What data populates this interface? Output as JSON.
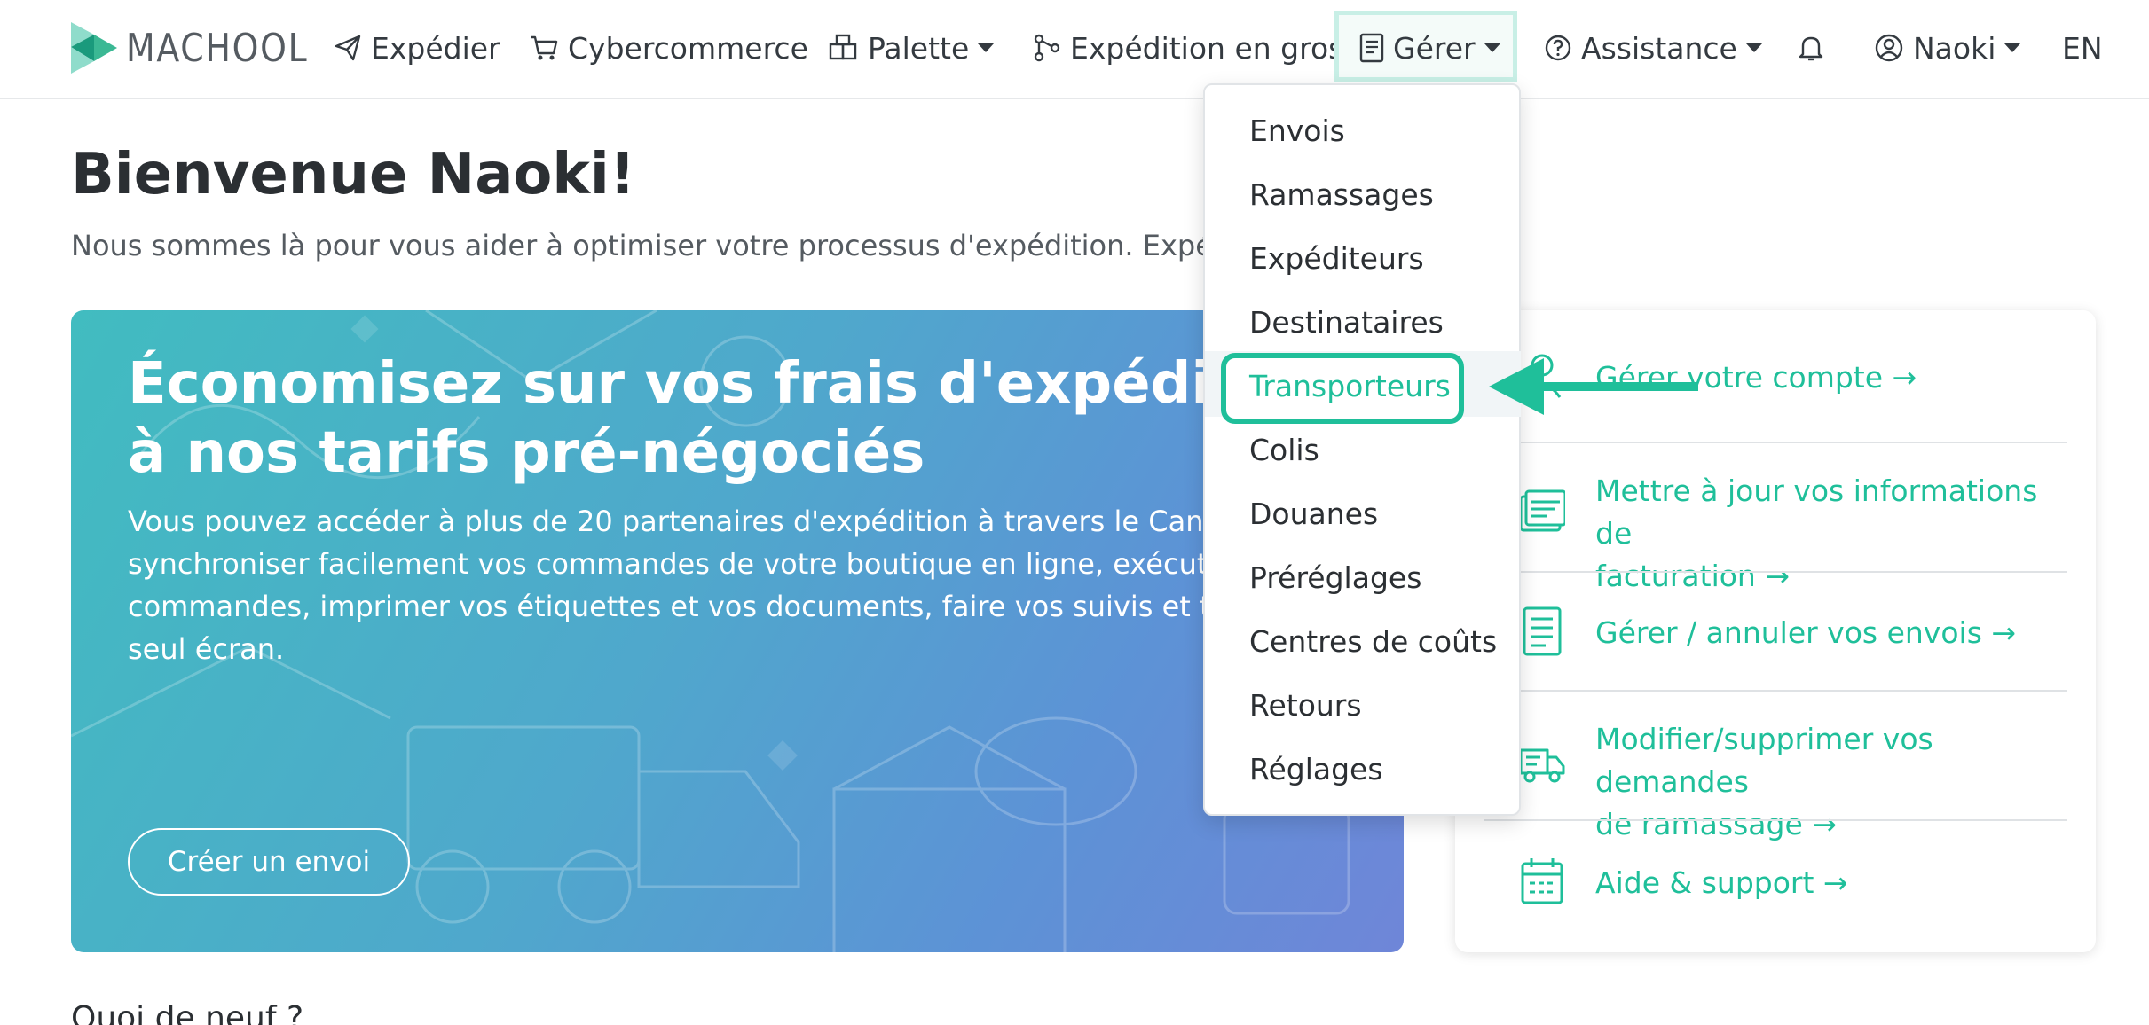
{
  "brand": {
    "name": "MACHOOL",
    "colors": {
      "accent": "#1fbf9a",
      "logo_dark": "#1a9a7c",
      "logo_light": "#8fdccb"
    }
  },
  "nav": {
    "items": [
      {
        "label": "Expédier",
        "icon": "paper-plane-icon"
      },
      {
        "label": "Cybercommerce",
        "icon": "cart-icon"
      },
      {
        "label": "Palette",
        "icon": "boxes-icon",
        "has_caret": true
      },
      {
        "label": "Expédition en gros",
        "icon": "share-nodes-icon"
      },
      {
        "label": "Gérer",
        "icon": "document-icon",
        "has_caret": true,
        "open": true
      },
      {
        "label": "Assistance",
        "icon": "question-circle-icon",
        "has_caret": true
      },
      {
        "label": "",
        "icon": "bell-icon"
      },
      {
        "label": "Naoki",
        "icon": "user-circle-icon",
        "has_caret": true
      },
      {
        "label": "EN"
      }
    ]
  },
  "page": {
    "title": "Bienvenue Naoki!",
    "subtitle": "Nous sommes là pour vous aider à optimiser votre processus d'expédition. Expédiez"
  },
  "hero": {
    "title_lines": [
      "Économisez sur vos frais d'expédition g",
      "à nos tarifs pré-négociés"
    ],
    "text_lines": [
      "Vous pouvez accéder à plus de 20 partenaires d'expédition à travers le Canada e",
      "synchroniser facilement vos commandes de votre boutique en ligne, exécuter et",
      "commandes, imprimer vos étiquettes et vos documents, faire vos suivis et tout c",
      "seul écran."
    ],
    "button_label": "Créer un envoi"
  },
  "side_links": [
    {
      "label": "Gérer votre compte →",
      "icon": "user-icon"
    },
    {
      "label_lines": [
        "Mettre à jour vos informations de",
        "facturation →"
      ],
      "icon": "invoice-icon"
    },
    {
      "label": "Gérer / annuler vos envois →",
      "icon": "clipboard-list-icon"
    },
    {
      "label_lines": [
        "Modifier/supprimer vos demandes",
        "de ramassage →"
      ],
      "icon": "truck-icon"
    },
    {
      "label": "Aide & support →",
      "icon": "calendar-icon"
    }
  ],
  "dropdown": {
    "items": [
      "Envois",
      "Ramassages",
      "Expéditeurs",
      "Destinataires",
      "Transporteurs",
      "Colis",
      "Douanes",
      "Préréglages",
      "Centres de coûts",
      "Retours",
      "Réglages"
    ],
    "highlighted": "Transporteurs"
  },
  "bottom": {
    "section_title": "Quoi de neuf ?"
  }
}
